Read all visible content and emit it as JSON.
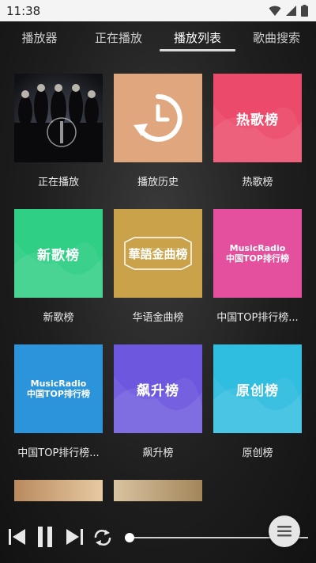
{
  "status_bar": {
    "time": "11:38"
  },
  "tabs": [
    {
      "label": "播放器",
      "active": false
    },
    {
      "label": "正在播放",
      "active": false
    },
    {
      "label": "播放列表",
      "active": true
    },
    {
      "label": "歌曲搜索",
      "active": false
    }
  ],
  "playlists": [
    {
      "caption": "正在播放",
      "cover_text": "",
      "cover": "album-photo"
    },
    {
      "caption": "播放历史",
      "cover_text": "",
      "cover": "history-icon",
      "color": "#e0a77e"
    },
    {
      "caption": "热歌榜",
      "cover_text": "热歌榜",
      "color": "#ec4a6a"
    },
    {
      "caption": "新歌榜",
      "cover_text": "新歌榜",
      "color": "#2fcf85"
    },
    {
      "caption": "华语金曲榜",
      "cover_text": "華語金曲榜",
      "color": "#c9a24a"
    },
    {
      "caption": "中国TOP排行榜...",
      "cover_text_top": "MusicRadio",
      "cover_text_bottom": "中国TOP排行榜",
      "color": "#e4509e"
    },
    {
      "caption": "中国TOP排行榜...",
      "cover_text_top": "MusicRadio",
      "cover_text_bottom": "中国TOP排行榜",
      "color": "#2c94da"
    },
    {
      "caption": "飙升榜",
      "cover_text": "飙升榜",
      "color": "#6d57df"
    },
    {
      "caption": "原创榜",
      "cover_text": "原创榜",
      "color": "#2fbde0"
    }
  ],
  "player": {
    "progress": 0
  }
}
